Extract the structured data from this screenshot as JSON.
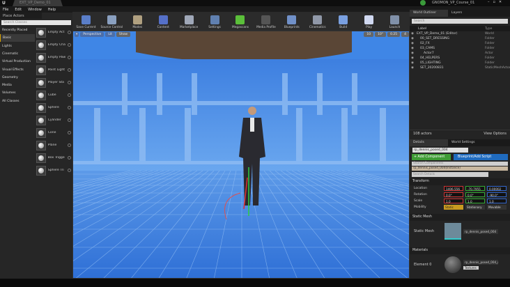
{
  "window": {
    "tab_title": "EXT_VP_Demo_01",
    "project": "GNOMON_VP_Course_01",
    "controls": [
      "–",
      "▫",
      "✕"
    ]
  },
  "menu": [
    "File",
    "Edit",
    "Window",
    "Help"
  ],
  "toolbar": [
    {
      "label": "Save Current",
      "color": "#5a7ec8"
    },
    {
      "label": "Source Control",
      "color": "#8aa0c0"
    },
    {
      "label": "Modes",
      "color": "#b0a080"
    },
    {
      "label": "Content",
      "color": "#5570c8"
    },
    {
      "label": "Marketplace",
      "color": "#a0a8b8"
    },
    {
      "label": "Settings",
      "color": "#6080b0"
    },
    {
      "label": "Megascans",
      "color": "#5bbf3a"
    },
    {
      "label": "Media Profile",
      "color": "#555"
    },
    {
      "label": "Blueprints",
      "color": "#7090c8"
    },
    {
      "label": "Cinematics",
      "color": "#9098a8"
    },
    {
      "label": "Build",
      "color": "#7aa0e0"
    },
    {
      "label": "Play",
      "color": "#d0d8f0"
    },
    {
      "label": "Launch",
      "color": "#8090a8"
    }
  ],
  "place_actors": {
    "title": "Place Actors",
    "search_placeholder": "Search Classes",
    "categories": [
      "Recently Placed",
      "Basic",
      "Lights",
      "Cinematic",
      "Virtual Production",
      "Visual Effects",
      "Geometry",
      "Media",
      "Volumes",
      "All Classes"
    ],
    "selected_category": "Basic",
    "items": [
      "Empty Act",
      "Empty Cha",
      "Empty Paw",
      "Point Light",
      "Player Sta",
      "Cube",
      "Sphere",
      "Cylinder",
      "Cone",
      "Plane",
      "Box Trigge",
      "Sphere Tri"
    ]
  },
  "viewport": {
    "view_mode": "Perspective",
    "lighting": "Lit",
    "show": "Show",
    "grid_snap": "10",
    "rotation_snap": "10°",
    "scale_snap": "0.25",
    "camera_speed": "4"
  },
  "outliner": {
    "tabs": [
      "World Outliner",
      "Layers"
    ],
    "search_placeholder": "Search",
    "col_label": "Label",
    "col_type": "Type",
    "rows": [
      {
        "label": "EXT_VP_Demo_01 (Editor)",
        "type": "World"
      },
      {
        "label": "00_SET_DRESSING",
        "type": "Folder"
      },
      {
        "label": "02_FX",
        "type": "Folder"
      },
      {
        "label": "03_CAMS",
        "type": "Folder"
      },
      {
        "label": "Actor7",
        "type": "Actor"
      },
      {
        "label": "04_HELPERS",
        "type": "Folder"
      },
      {
        "label": "05_LIGHTING",
        "type": "Folder"
      },
      {
        "label": "SET_20200831",
        "type": "StaticMeshActor"
      }
    ],
    "count": "108 actors",
    "view_options": "View Options"
  },
  "details": {
    "tabs": [
      "Details",
      "World Settings"
    ],
    "name": "rp_dennis_posed_004",
    "add_component": "+ Add Component",
    "blueprint": "Blueprint/Add Script",
    "search_components": "Search Components",
    "instance": "rp_dennis_posed_004(Instance)",
    "search_details": "Search Details",
    "transform": "Transform",
    "location": {
      "label": "Location",
      "x": "1406.556",
      "y": "-70.7955",
      "z": "0.00002"
    },
    "rotation": {
      "label": "Rotation",
      "x": "0.0°",
      "y": "0.0°",
      "z": "-90.0°"
    },
    "scale": {
      "label": "Scale",
      "x": "1.0",
      "y": "1.0",
      "z": "1.0"
    },
    "mobility": {
      "label": "Mobility",
      "options": [
        "Static",
        "Stationary",
        "Movable"
      ],
      "selected": "Static"
    },
    "static_mesh_section": "Static Mesh",
    "static_mesh_label": "Static Mesh",
    "static_mesh_value": "rp_dennis_posed_004",
    "materials_section": "Materials",
    "element_label": "Element 0",
    "material_value": "rp_dennis_posed_004_mat",
    "textures": "Textures"
  },
  "colors": {
    "accent": "#d7a100",
    "add_component": "#3f9c35",
    "blueprint": "#1f6bbf",
    "viewport_overlay": "#3f86e6"
  }
}
